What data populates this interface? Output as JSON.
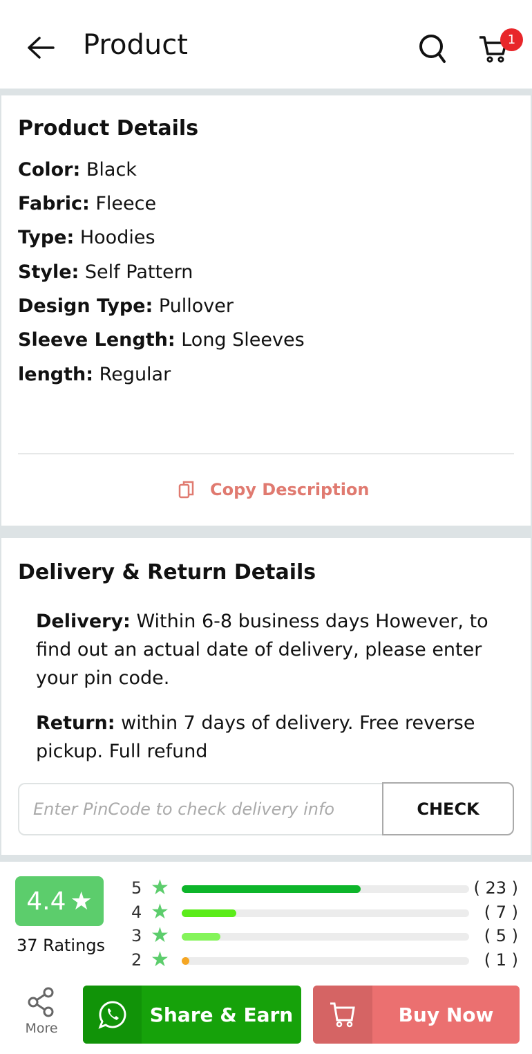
{
  "header": {
    "title": "Product",
    "cart_count": "1"
  },
  "product_details": {
    "title": "Product Details",
    "rows": [
      {
        "label": "Color:",
        "value": "Black"
      },
      {
        "label": "Fabric:",
        "value": "Fleece"
      },
      {
        "label": "Type:",
        "value": "Hoodies"
      },
      {
        "label": "Style:",
        "value": "Self Pattern"
      },
      {
        "label": "Design Type:",
        "value": "Pullover"
      },
      {
        "label": "Sleeve Length:",
        "value": "Long Sleeves"
      },
      {
        "label": "length:",
        "value": "Regular"
      }
    ],
    "copy_label": "Copy Description"
  },
  "delivery": {
    "title": "Delivery & Return Details",
    "delivery_label": "Delivery:",
    "delivery_text": "Within 6-8 business days However, to find out an actual date of delivery, please enter your pin code.",
    "return_label": "Return:",
    "return_text": "within 7 days of delivery. Free reverse pickup. Full refund",
    "pincode_placeholder": "Enter PinCode to check delivery info",
    "check_label": "CHECK"
  },
  "ratings": {
    "average": "4.4",
    "count_label": "37 Ratings",
    "total": 37,
    "breakdown": [
      {
        "star": "5",
        "count": 23,
        "count_label": "( 23 )",
        "color": "#0db52a"
      },
      {
        "star": "4",
        "count": 7,
        "count_label": "( 7 )",
        "color": "#5bec1a"
      },
      {
        "star": "3",
        "count": 5,
        "count_label": "( 5 )",
        "color": "#84f45a"
      },
      {
        "star": "2",
        "count": 1,
        "count_label": "( 1 )",
        "color": "#f5a623"
      }
    ]
  },
  "bottom_bar": {
    "more_label": "More",
    "share_label": "Share & Earn",
    "buy_label": "Buy Now"
  },
  "colors": {
    "accent_green": "#16a20a",
    "buy": "#eb7070",
    "copy": "#e07a70",
    "badge": "#5ccd6c",
    "cart_badge": "#e8262a"
  }
}
